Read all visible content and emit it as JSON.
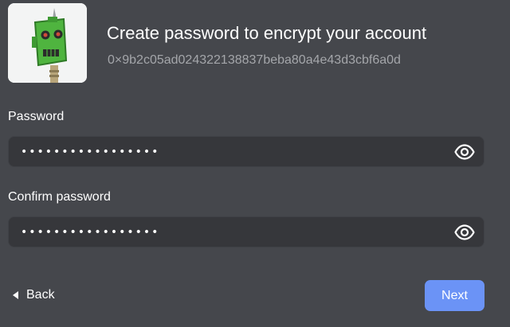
{
  "header": {
    "title": "Create password to encrypt your account",
    "address": "0×9b2c05ad024322138837beba80a4e43d3cbf6a0d",
    "avatar_icon": "robot-avatar-icon"
  },
  "form": {
    "password_label": "Password",
    "password_value": "•••••••••••••••••",
    "password_icon": "eye-icon",
    "confirm_label": "Confirm password",
    "confirm_value": "•••••••••••••••••",
    "confirm_icon": "eye-icon"
  },
  "footer": {
    "back_label": "Back",
    "next_label": "Next"
  },
  "colors": {
    "background": "#45474c",
    "field_background": "#36373b",
    "accent": "#6b93f6",
    "muted_text": "#a4a6aa"
  }
}
